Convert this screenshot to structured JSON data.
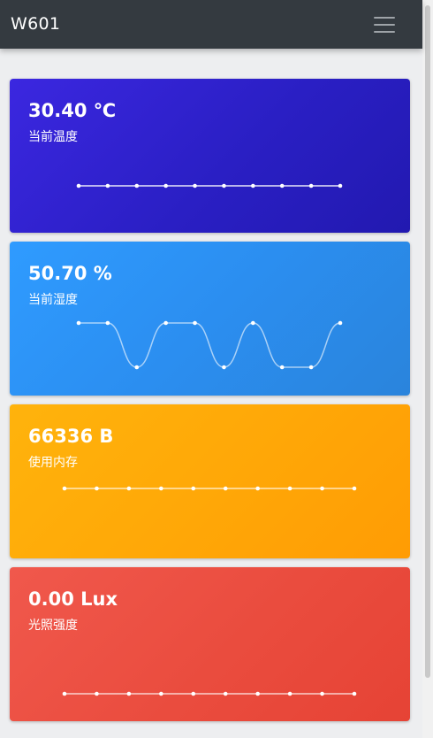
{
  "navbar": {
    "brand": "W601",
    "menu_icon": "hamburger-menu-icon"
  },
  "cards": {
    "temperature": {
      "value": "30.40 ℃",
      "label": "当前温度",
      "color": "#2a1fc4",
      "sparkline": [
        30.4,
        30.4,
        30.4,
        30.4,
        30.4,
        30.4,
        30.4,
        30.4,
        30.4,
        30.4
      ]
    },
    "humidity": {
      "value": "50.70 %",
      "label": "当前湿度",
      "color": "#2b8ef0",
      "sparkline": [
        50.8,
        50.8,
        50.7,
        50.8,
        50.8,
        50.7,
        50.8,
        50.7,
        50.7,
        50.8
      ]
    },
    "memory": {
      "value": "66336 B",
      "label": "使用内存",
      "color": "#ffa707",
      "sparkline": [
        66336,
        66336,
        66336,
        66336,
        66336,
        66336,
        66336,
        66336,
        66336,
        66336
      ]
    },
    "light": {
      "value": "0.00 Lux",
      "label": "光照强度",
      "color": "#ea4c3e",
      "sparkline": [
        0,
        0,
        0,
        0,
        0,
        0,
        0,
        0,
        0,
        0
      ]
    }
  }
}
